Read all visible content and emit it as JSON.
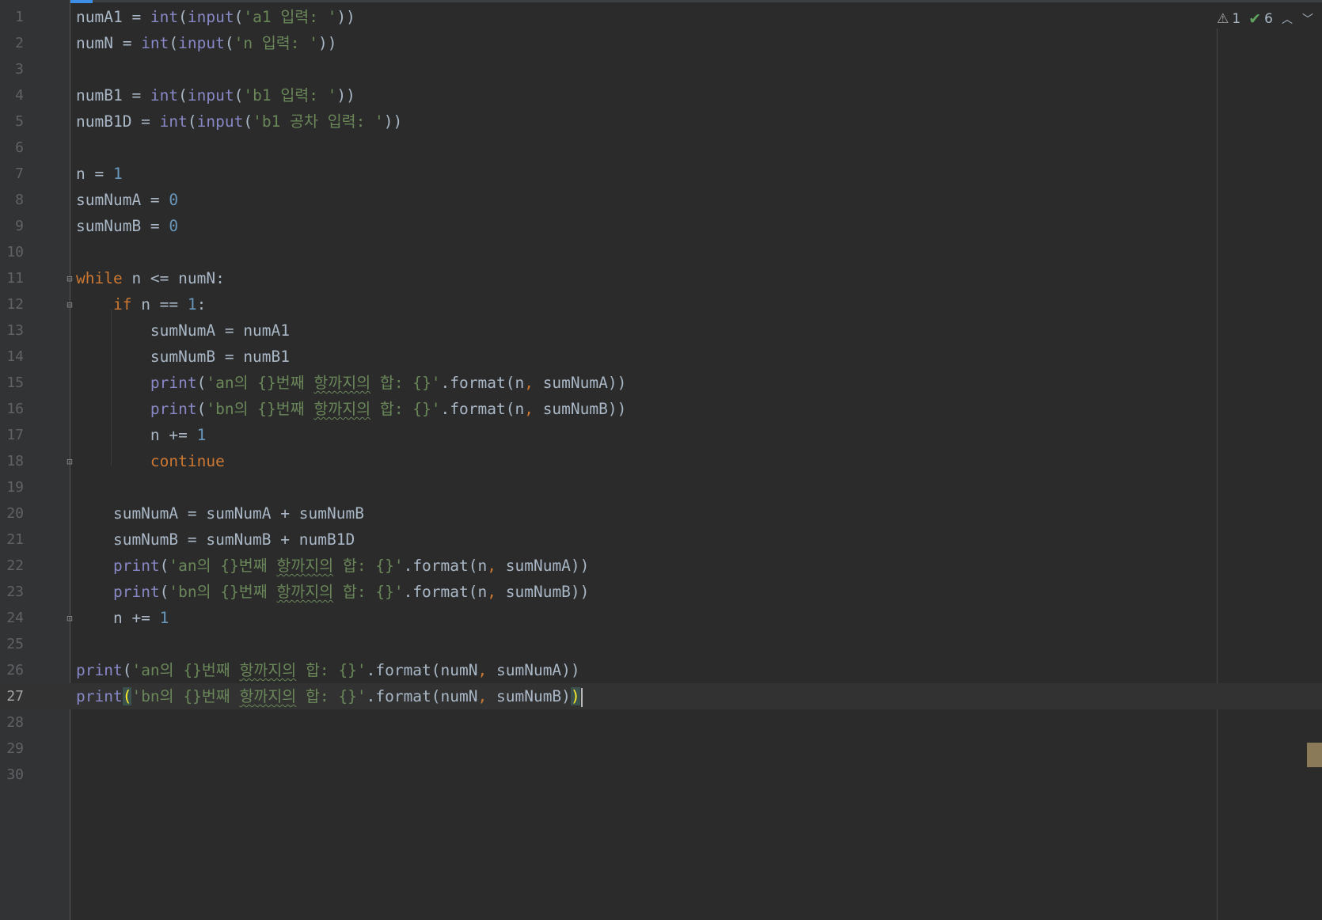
{
  "lines": [
    {
      "n": "1",
      "t": [
        [
          "v",
          "numA1 = "
        ],
        [
          "bi",
          "int"
        ],
        [
          "v",
          "("
        ],
        [
          "bi",
          "input"
        ],
        [
          "v",
          "("
        ],
        [
          "st",
          "'a1 입력: '"
        ],
        [
          "v",
          "))"
        ]
      ]
    },
    {
      "n": "2",
      "t": [
        [
          "v",
          "numN = "
        ],
        [
          "bi",
          "int"
        ],
        [
          "v",
          "("
        ],
        [
          "bi",
          "input"
        ],
        [
          "v",
          "("
        ],
        [
          "st",
          "'n 입력: '"
        ],
        [
          "v",
          "))"
        ]
      ]
    },
    {
      "n": "3",
      "t": []
    },
    {
      "n": "4",
      "t": [
        [
          "v",
          "numB1 = "
        ],
        [
          "bi",
          "int"
        ],
        [
          "v",
          "("
        ],
        [
          "bi",
          "input"
        ],
        [
          "v",
          "("
        ],
        [
          "st",
          "'b1 입력: '"
        ],
        [
          "v",
          "))"
        ]
      ]
    },
    {
      "n": "5",
      "t": [
        [
          "v",
          "numB1D = "
        ],
        [
          "bi",
          "int"
        ],
        [
          "v",
          "("
        ],
        [
          "bi",
          "input"
        ],
        [
          "v",
          "("
        ],
        [
          "st",
          "'b1 공차 입력: '"
        ],
        [
          "v",
          "))"
        ]
      ]
    },
    {
      "n": "6",
      "t": []
    },
    {
      "n": "7",
      "t": [
        [
          "v",
          "n = "
        ],
        [
          "nm",
          "1"
        ]
      ]
    },
    {
      "n": "8",
      "t": [
        [
          "v",
          "sumNumA = "
        ],
        [
          "nm",
          "0"
        ]
      ]
    },
    {
      "n": "9",
      "t": [
        [
          "v",
          "sumNumB = "
        ],
        [
          "nm",
          "0"
        ]
      ]
    },
    {
      "n": "10",
      "t": []
    },
    {
      "n": "11",
      "t": [
        [
          "kw",
          "while"
        ],
        [
          "v",
          " n <= numN:"
        ]
      ]
    },
    {
      "n": "12",
      "t": [
        [
          "v",
          "    "
        ],
        [
          "kw",
          "if"
        ],
        [
          "v",
          " n == "
        ],
        [
          "nm",
          "1"
        ],
        [
          "v",
          ":"
        ]
      ]
    },
    {
      "n": "13",
      "t": [
        [
          "v",
          "        sumNumA = numA1"
        ]
      ]
    },
    {
      "n": "14",
      "t": [
        [
          "v",
          "        sumNumB = numB1"
        ]
      ]
    },
    {
      "n": "15",
      "t": [
        [
          "v",
          "        "
        ],
        [
          "bi",
          "print"
        ],
        [
          "v",
          "("
        ],
        [
          "st",
          "'an의 {}번째 "
        ],
        [
          "sq",
          "항까지의"
        ],
        [
          "st",
          " 합: {}'"
        ],
        [
          "v",
          ".format(n"
        ],
        [
          "cm",
          ","
        ],
        [
          "v",
          " sumNumA))"
        ]
      ]
    },
    {
      "n": "16",
      "t": [
        [
          "v",
          "        "
        ],
        [
          "bi",
          "print"
        ],
        [
          "v",
          "("
        ],
        [
          "st",
          "'bn의 {}번째 "
        ],
        [
          "sq",
          "항까지의"
        ],
        [
          "st",
          " 합: {}'"
        ],
        [
          "v",
          ".format(n"
        ],
        [
          "cm",
          ","
        ],
        [
          "v",
          " sumNumB))"
        ]
      ]
    },
    {
      "n": "17",
      "t": [
        [
          "v",
          "        n += "
        ],
        [
          "nm",
          "1"
        ]
      ]
    },
    {
      "n": "18",
      "t": [
        [
          "v",
          "        "
        ],
        [
          "kw",
          "continue"
        ]
      ]
    },
    {
      "n": "19",
      "t": []
    },
    {
      "n": "20",
      "t": [
        [
          "v",
          "    sumNumA = sumNumA + sumNumB"
        ]
      ]
    },
    {
      "n": "21",
      "t": [
        [
          "v",
          "    sumNumB = sumNumB + numB1D"
        ]
      ]
    },
    {
      "n": "22",
      "t": [
        [
          "v",
          "    "
        ],
        [
          "bi",
          "print"
        ],
        [
          "v",
          "("
        ],
        [
          "st",
          "'an의 {}번째 "
        ],
        [
          "sq",
          "항까지의"
        ],
        [
          "st",
          " 합: {}'"
        ],
        [
          "v",
          ".format(n"
        ],
        [
          "cm",
          ","
        ],
        [
          "v",
          " sumNumA))"
        ]
      ]
    },
    {
      "n": "23",
      "t": [
        [
          "v",
          "    "
        ],
        [
          "bi",
          "print"
        ],
        [
          "v",
          "("
        ],
        [
          "st",
          "'bn의 {}번째 "
        ],
        [
          "sq",
          "항까지의"
        ],
        [
          "st",
          " 합: {}'"
        ],
        [
          "v",
          ".format(n"
        ],
        [
          "cm",
          ","
        ],
        [
          "v",
          " sumNumB))"
        ]
      ]
    },
    {
      "n": "24",
      "t": [
        [
          "v",
          "    n += "
        ],
        [
          "nm",
          "1"
        ]
      ]
    },
    {
      "n": "25",
      "t": []
    },
    {
      "n": "26",
      "t": [
        [
          "bi",
          "print"
        ],
        [
          "v",
          "("
        ],
        [
          "st",
          "'an의 {}번째 "
        ],
        [
          "sq",
          "항까지의"
        ],
        [
          "st",
          " 합: {}'"
        ],
        [
          "v",
          ".format(numN"
        ],
        [
          "cm",
          ","
        ],
        [
          "v",
          " sumNumA))"
        ]
      ]
    },
    {
      "n": "27",
      "t": [
        [
          "bi",
          "print"
        ],
        [
          "hl",
          "("
        ],
        [
          "st",
          "'bn의 {}번째 "
        ],
        [
          "sq",
          "항까지의"
        ],
        [
          "st",
          " 합: {}'"
        ],
        [
          "v",
          ".format(numN"
        ],
        [
          "cm",
          ","
        ],
        [
          "v",
          " sumNumB)"
        ],
        [
          "hl",
          ")"
        ],
        [
          "caret",
          ""
        ]
      ]
    },
    {
      "n": "28",
      "t": []
    },
    {
      "n": "29",
      "t": []
    },
    {
      "n": "30",
      "t": []
    }
  ],
  "current_line": "27",
  "fold_markers": {
    "11": "⊟",
    "12": "⊟",
    "18": "⊡",
    "24": "⊡"
  },
  "inspections": {
    "warnings": "1",
    "weak_warnings": "6",
    "warning_icon": "warning-triangle-icon",
    "check_icon": "checkmark-icon"
  },
  "colors": {
    "background": "#2b2b2b",
    "keyword": "#cc7832",
    "builtin": "#8888c6",
    "string": "#6a8759",
    "number": "#6897bb",
    "text": "#a9b7c6"
  }
}
